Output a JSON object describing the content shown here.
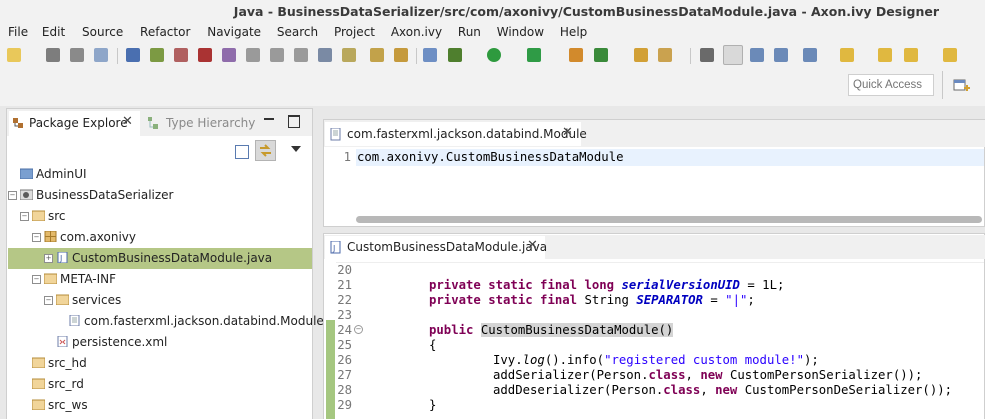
{
  "window": {
    "title": "Java - BusinessDataSerializer/src/com/axonivy/CustomBusinessDataModule.java - Axon.ivy Designer"
  },
  "menu": [
    "File",
    "Edit",
    "Source",
    "Refactor",
    "Navigate",
    "Search",
    "Project",
    "Axon.ivy",
    "Run",
    "Window",
    "Help"
  ],
  "quick_access": {
    "placeholder": "Quick Access"
  },
  "explorer": {
    "tabs": {
      "package": "Package Explore",
      "hierarchy": "Type Hierarchy"
    },
    "tree": [
      {
        "label": "AdminUI"
      },
      {
        "label": "BusinessDataSerializer"
      },
      {
        "label": "src"
      },
      {
        "label": "com.axonivy"
      },
      {
        "label": "CustomBusinessDataModule.java"
      },
      {
        "label": "META-INF"
      },
      {
        "label": "services"
      },
      {
        "label": "com.fasterxml.jackson.databind.Module"
      },
      {
        "label": "persistence.xml"
      },
      {
        "label": "src_hd"
      },
      {
        "label": "src_rd"
      },
      {
        "label": "src_ws"
      }
    ]
  },
  "editor1": {
    "tab": "com.fasterxml.jackson.databind.Module",
    "line_number": "1",
    "content": "com.axonivy.CustomBusinessDataModule"
  },
  "editor2": {
    "tab": "CustomBusinessDataModule.java",
    "line_numbers": [
      "20",
      "21",
      "22",
      "23",
      "24",
      "25",
      "26",
      "27",
      "28",
      "29"
    ],
    "lines": {
      "l21_kw": "private static final long ",
      "l21_field": "serialVersionUID",
      "l21_rest": " = 1L;",
      "l22_kw": "private static final ",
      "l22_type": "String ",
      "l22_field": "SEPARATOR",
      "l22_eq": " = ",
      "l22_str": "\"|\"",
      "l22_end": ";",
      "l24_kw": "public ",
      "l24_name": "CustomBusinessDataModule()",
      "l25": "{",
      "l26_a": "Ivy.",
      "l26_log": "log",
      "l26_b": "().info(",
      "l26_str": "\"registered custom module!\"",
      "l26_c": ");",
      "l27_a": "addSerializer(Person.",
      "l27_kw1": "class",
      "l27_b": ", ",
      "l27_kw2": "new",
      "l27_c": " CustomPersonSerializer());",
      "l28_a": "addDeserializer(Person.",
      "l28_kw1": "class",
      "l28_b": ", ",
      "l28_kw2": "new",
      "l28_c": " CustomPersonDeSerializer());",
      "l29": "}"
    }
  },
  "colors": {
    "selection": "#b5c786",
    "keyword": "#7f0055",
    "field": "#0000c0",
    "string": "#2a00ff"
  }
}
